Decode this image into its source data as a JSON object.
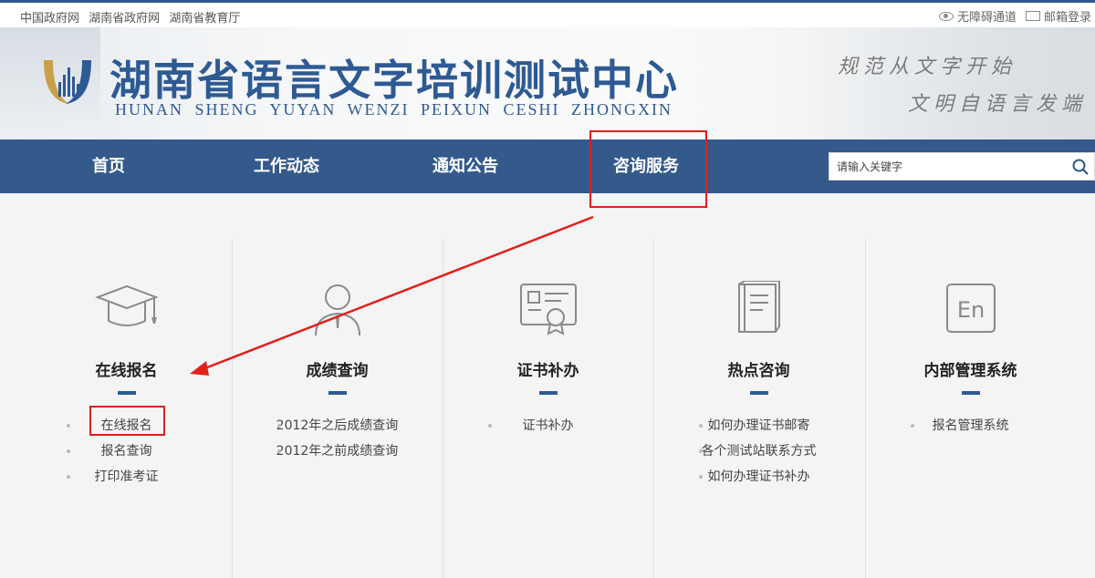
{
  "top_links": [
    "中国政府网",
    "湖南省政府网",
    "湖南省教育厅"
  ],
  "top_right": {
    "accessibility": "无障碍通道",
    "mail": "邮箱登录"
  },
  "header": {
    "title": "湖南省语言文字培训测试中心",
    "subtitle": "HUNAN SHENG YUYAN WENZI PEIXUN CESHI ZHONGXIN",
    "slogan_1": "规范从文字开始",
    "slogan_2": "文明自语言发端"
  },
  "nav": {
    "items": [
      {
        "label": "首页"
      },
      {
        "label": "工作动态"
      },
      {
        "label": "通知公告"
      },
      {
        "label": "咨询服务"
      }
    ],
    "search_placeholder": "请输入关键字"
  },
  "columns": [
    {
      "icon": "graduation-cap-icon",
      "title": "在线报名",
      "links": [
        "在线报名",
        "报名查询",
        "打印准考证"
      ]
    },
    {
      "icon": "person-icon",
      "title": "成绩查询",
      "links": [
        "2012年之后成绩查询",
        "2012年之前成绩查询"
      ]
    },
    {
      "icon": "certificate-icon",
      "title": "证书补办",
      "links": [
        "证书补办"
      ]
    },
    {
      "icon": "book-icon",
      "title": "热点咨询",
      "links": [
        "如何办理证书邮寄",
        "各个测试站联系方式",
        "如何办理证书补办"
      ]
    },
    {
      "icon": "en-icon",
      "title": "内部管理系统",
      "links": [
        "报名管理系统"
      ]
    }
  ],
  "colors": {
    "nav_bg": "#34598b",
    "brand_blue": "#2e5a94",
    "annotation_red": "#e0201b"
  }
}
